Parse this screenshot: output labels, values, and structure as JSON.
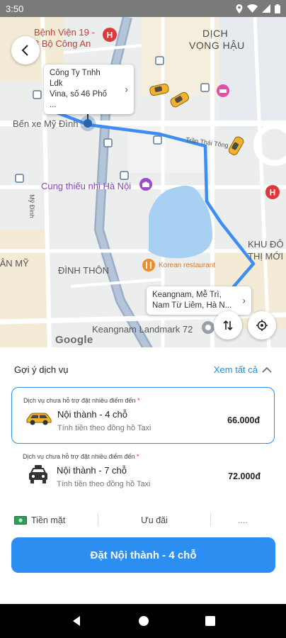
{
  "status_bar": {
    "time": "3:50"
  },
  "map": {
    "labels": {
      "hospital": "Bệnh Viện 19 - 8 Bộ Công An",
      "dich": "DỊCH",
      "vong_hau": "VỌNG HẬU",
      "ben_xe": "Bến xe Mỹ Đình",
      "tran_thai": "Trần Thái Tông",
      "cung_thieu_nhi": "Cung thiếu nhi Hà Nội",
      "dinh_thon": "ĐÌNH THÔN",
      "an_my": "IÂN MỸ",
      "khu_do": "KHU ĐÔ",
      "thi_moi": "THỊ MỚI",
      "korean": "Korean restaurant",
      "keangnam": "Keangnam Landmark 72",
      "my_dinh": "Mỹ Đình",
      "google": "Google"
    },
    "pickup_tip": {
      "line1": "Công Ty Tnhh Ldk",
      "line2": "Vina, số 46 Phố ..."
    },
    "dropoff_tip": {
      "line1": "Keangnam, Mễ Trì,",
      "line2": "Nam Từ Liêm, Hà N..."
    }
  },
  "sheet": {
    "heading": "Gợi ý dịch vụ",
    "see_all": "Xem tất cả",
    "services": [
      {
        "note": "Dịch vụ chưa hỗ trợ đặt nhiều điểm đến",
        "name": "Nội thành - 4 chỗ",
        "sub": "Tính tiền theo đồng hồ Taxi",
        "price": "66.000đ",
        "selected": true
      },
      {
        "note": "Dịch vụ chưa hỗ trợ đặt nhiều điểm đến",
        "name": "Nội thành - 7 chỗ",
        "sub": "Tính tiền theo đồng hồ Taxi",
        "price": "72.000đ",
        "selected": false
      }
    ],
    "payment": "Tiền mặt",
    "promo": "Ưu đãi",
    "more": "....",
    "cta": "Đặt Nội thành - 4 chỗ"
  },
  "colors": {
    "accent": "#2b8ef0",
    "route": "#3c8ef2",
    "taxi": "#f2b12a"
  }
}
